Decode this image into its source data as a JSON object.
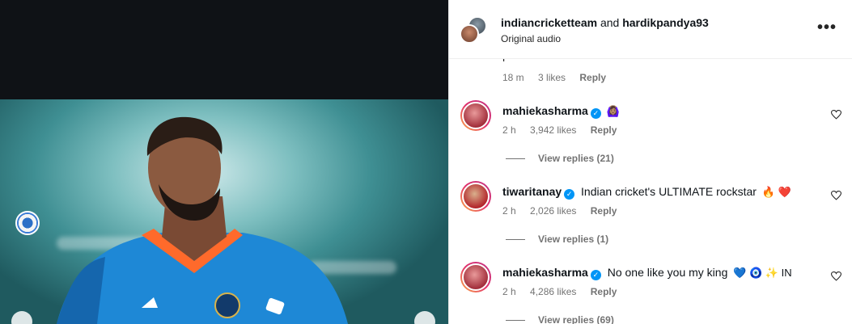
{
  "post": {
    "authors_line": {
      "first": "indiancricketteam",
      "joiner": "and",
      "second": "hardikpandya93"
    },
    "audio_label": "Original audio",
    "more_label": "•••"
  },
  "clipped_comment": {
    "text": "performance",
    "time": "18 m",
    "likes": "3 likes",
    "reply": "Reply"
  },
  "comments": [
    {
      "username": "mahiekasharma",
      "verified": true,
      "text": "",
      "emojis": "🙆🏽‍♀️",
      "time": "2 h",
      "likes": "3,942 likes",
      "reply": "Reply",
      "view_replies": "View replies (21)",
      "avatar": "pink"
    },
    {
      "username": "tiwaritanay",
      "verified": true,
      "text": "Indian cricket's ULTIMATE rockstar",
      "emojis": "🔥 ❤️",
      "time": "2 h",
      "likes": "2,026 likes",
      "reply": "Reply",
      "view_replies": "View replies (1)",
      "avatar": "red"
    },
    {
      "username": "mahiekasharma",
      "verified": true,
      "text": "No one like you my king",
      "emojis": "💙 🧿 ✨ IN",
      "time": "2 h",
      "likes": "4,286 likes",
      "reply": "Reply",
      "view_replies": "View replies (69)",
      "avatar": "pink"
    }
  ],
  "icons": {
    "verified": "verified-badge-icon",
    "heart": "heart-outline-icon",
    "more": "more-options-icon",
    "nav": "chevron-icon"
  },
  "colors": {
    "verified_blue": "#0095f6",
    "muted_text": "#737373",
    "story_ring": "#e1306c"
  }
}
